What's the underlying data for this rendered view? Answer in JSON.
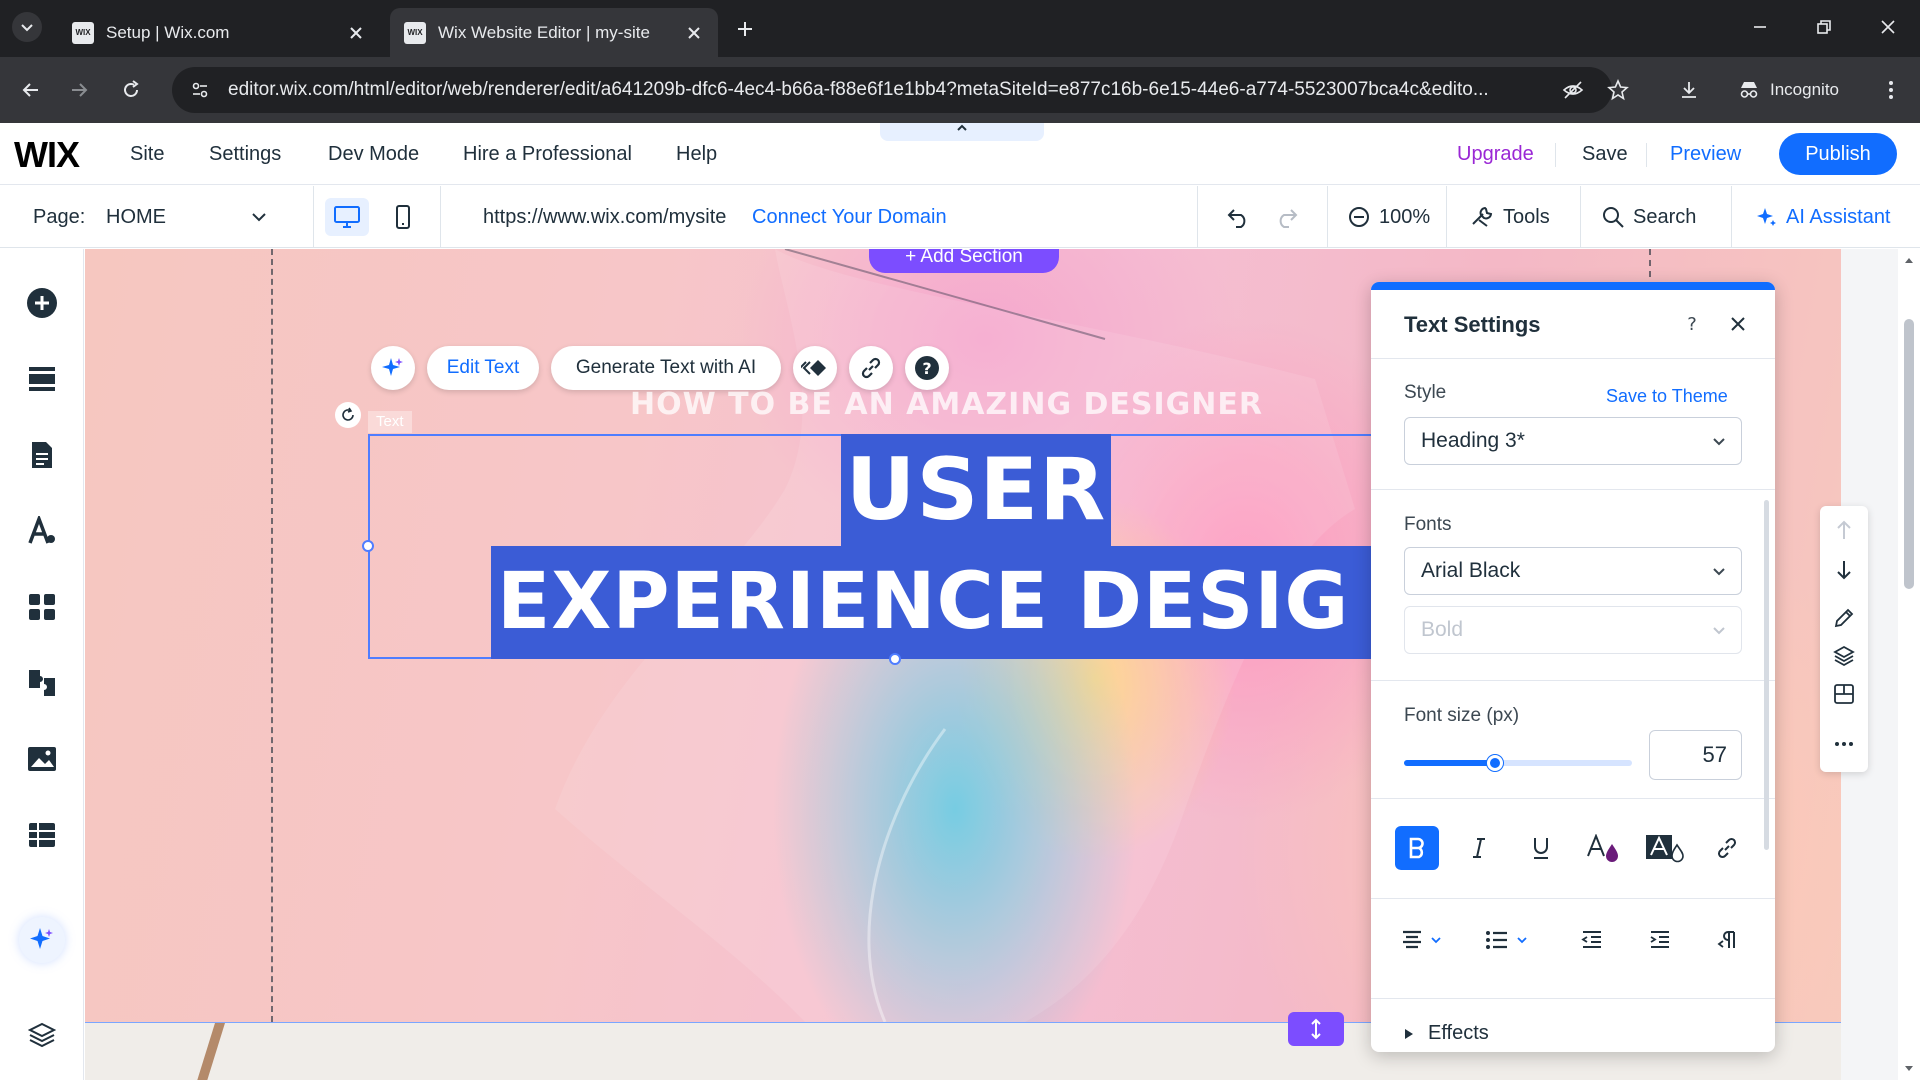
{
  "browser": {
    "tabs": [
      {
        "title": "Setup | Wix.com",
        "favicon": "wix-favicon",
        "active": false
      },
      {
        "title": "Wix Website Editor | my-site",
        "favicon": "wix-favicon",
        "active": true
      }
    ],
    "url": "editor.wix.com/html/editor/web/renderer/edit/a641209b-dfc6-4ec4-b66a-f88e6f1e1bb4?metaSiteId=e877c16b-6e15-44e6-a774-5523007bca4c&edito...",
    "incognito_label": "Incognito"
  },
  "wix_topbar": {
    "logo": "WIX",
    "menu": [
      "Site",
      "Settings",
      "Dev Mode",
      "Hire a Professional",
      "Help"
    ],
    "upgrade": "Upgrade",
    "save": "Save",
    "preview": "Preview",
    "publish": "Publish"
  },
  "wix_toolbar": {
    "page_label": "Page:",
    "page_value": "HOME",
    "site_url": "https://www.wix.com/mysite",
    "connect_domain": "Connect Your Domain",
    "zoom": "100%",
    "tools": "Tools",
    "search": "Search",
    "ai_assistant": "AI Assistant"
  },
  "left_rail": {
    "icons": [
      "add-elements-icon",
      "sections-icon",
      "pages-icon",
      "site-design-icon",
      "apps-icon",
      "business-apps-icon",
      "media-icon",
      "cms-icon",
      "ai-sparkle-icon",
      "layers-icon"
    ]
  },
  "canvas": {
    "add_section": "+ Add Section",
    "floating_toolbar": {
      "edit_text": "Edit Text",
      "generate_text": "Generate Text with AI"
    },
    "element_tag": "Text",
    "subheading": "HOW TO BE AN AMAZING DESIGNER",
    "heading_line1": "USER",
    "heading_line2": "EXPERIENCE DESIG"
  },
  "text_settings": {
    "title": "Text Settings",
    "style_label": "Style",
    "save_to_theme": "Save to Theme",
    "style_value": "Heading 3*",
    "fonts_label": "Fonts",
    "font_value": "Arial Black",
    "weight_value": "Bold",
    "font_size_label": "Font size (px)",
    "font_size_value": "57",
    "font_size_slider_fraction": 0.4,
    "effects_label": "Effects",
    "accent_color": "#116dff"
  }
}
